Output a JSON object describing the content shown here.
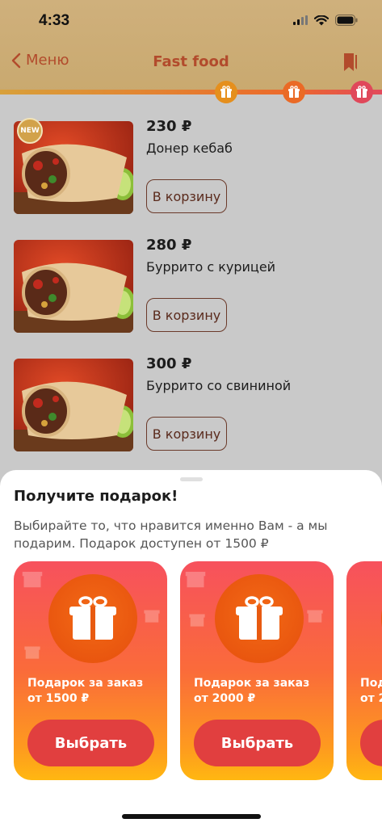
{
  "status_bar": {
    "time": "4:33"
  },
  "nav": {
    "back_label": "Меню",
    "title": "Fast food"
  },
  "colors": {
    "accent": "#b24b2c",
    "header_bg": "#c9a96f",
    "button_red": "#e13f3f",
    "card_top": "#f7515d",
    "card_bottom": "#ffb711"
  },
  "progress": {
    "fill_fraction": 1.0
  },
  "products": [
    {
      "price": "230 ₽",
      "name": "Донер кебаб",
      "button": "В корзину",
      "badge": "NEW"
    },
    {
      "price": "280 ₽",
      "name": "Буррито с курицей",
      "button": "В корзину"
    },
    {
      "price": "300 ₽",
      "name": "Буррито со свининой",
      "button": "В корзину"
    }
  ],
  "gift_sheet": {
    "title": "Получите подарок!",
    "description": "Выбирайте то, что нравится именно Вам - а мы подарим. Подарок доступен от 1500 ₽",
    "cards": [
      {
        "label_line1": "Подарок за заказ",
        "label_line2": "от 1500 ₽",
        "button": "Выбрать"
      },
      {
        "label_line1": "Подарок за заказ",
        "label_line2": "от 2000 ₽",
        "button": "Выбрать"
      },
      {
        "label_line1": "Под",
        "label_line2": "от 2",
        "button": ""
      }
    ]
  },
  "icons": [
    "back-chevron-icon",
    "bookmark-icon",
    "gift-icon",
    "wifi-icon",
    "battery-icon",
    "signal-icon"
  ]
}
